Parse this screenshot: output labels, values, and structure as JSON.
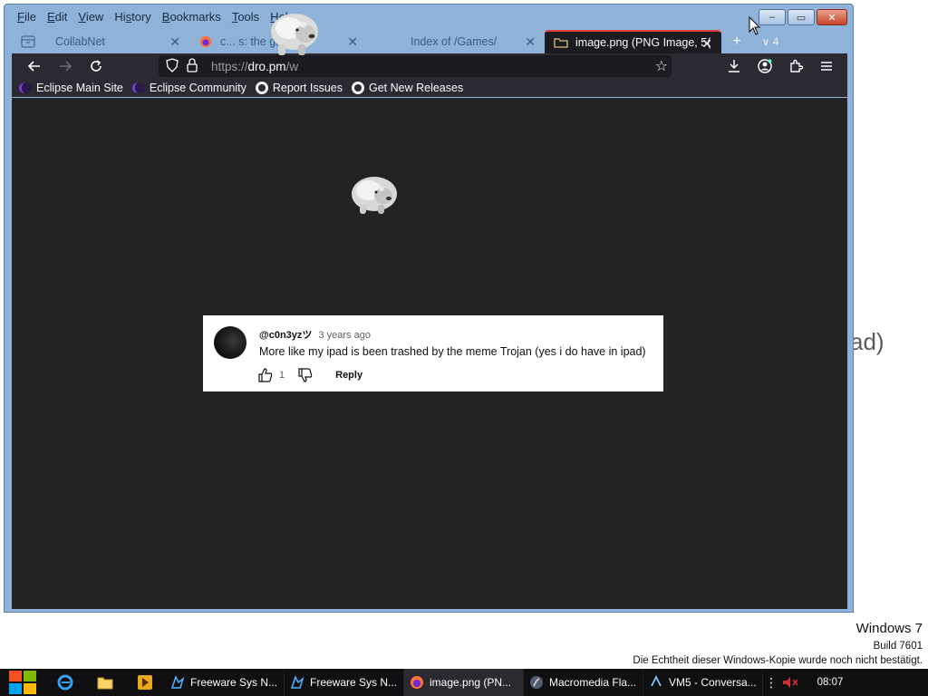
{
  "desktop": {
    "fragment_text": "ad)"
  },
  "browser": {
    "menu": [
      "File",
      "Edit",
      "View",
      "History",
      "Bookmarks",
      "Tools",
      "Help"
    ],
    "menu_underline": [
      "F",
      "E",
      "V",
      "s",
      "B",
      "T",
      "H"
    ],
    "tabs": [
      {
        "title": "CollabNet",
        "icon": "container-icon"
      },
      {
        "title": "c... s: the game",
        "icon": "firefox-icon"
      },
      {
        "title": "Index of /Games/",
        "icon": ""
      },
      {
        "title": "image.png (PNG Image, 5(",
        "icon": "image-icon",
        "active": true
      }
    ],
    "tab_count": "4",
    "url": {
      "scheme": "https://",
      "host": "dro.pm",
      "path": "/w"
    },
    "bookmarks": [
      {
        "label": "Eclipse Main Site",
        "icon": "eclipse-icon"
      },
      {
        "label": "Eclipse Community",
        "icon": "eclipse-icon"
      },
      {
        "label": "Report Issues",
        "icon": "github-icon"
      },
      {
        "label": "Get New Releases",
        "icon": "github-icon"
      }
    ],
    "window_buttons": {
      "minimize": "–",
      "restore": "▭",
      "close": "✕"
    }
  },
  "comment": {
    "author": "@c0n3yzツ",
    "time": "3 years ago",
    "text": "More like my ipad is been trashed by the meme Trojan (yes i do have in ipad)",
    "likes": "1",
    "reply_label": "Reply"
  },
  "watermark": {
    "os": "Windows 7",
    "build": "Build 7601",
    "notice": "Die Echtheit dieser Windows-Kopie wurde noch nicht bestätigt."
  },
  "taskbar": {
    "tasks": [
      {
        "label": "Freeware Sys N...",
        "icon": "app-icon"
      },
      {
        "label": "Freeware Sys N...",
        "icon": "app-icon"
      },
      {
        "label": "image.png (PN...",
        "icon": "firefox-icon",
        "active": true
      },
      {
        "label": "Macromedia Fla...",
        "icon": "flash-icon"
      },
      {
        "label": "VM5 - Conversa...",
        "icon": "vm-icon"
      }
    ],
    "clock": "08:07"
  }
}
